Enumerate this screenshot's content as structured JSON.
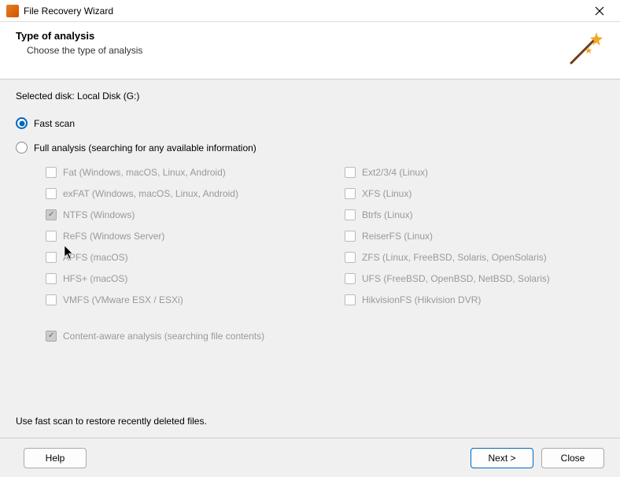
{
  "window": {
    "title": "File Recovery Wizard"
  },
  "header": {
    "heading": "Type of analysis",
    "subheading": "Choose the type of analysis"
  },
  "main": {
    "selected_disk_label": "Selected disk: Local Disk (G:)",
    "radio": {
      "fast": {
        "label": "Fast scan",
        "selected": true
      },
      "full": {
        "label": "Full analysis (searching for any available information)",
        "selected": false
      }
    },
    "filesystems_left": [
      {
        "label": "Fat (Windows, macOS, Linux, Android)",
        "checked": false
      },
      {
        "label": "exFAT (Windows, macOS, Linux, Android)",
        "checked": false
      },
      {
        "label": "NTFS (Windows)",
        "checked": true
      },
      {
        "label": "ReFS (Windows Server)",
        "checked": false
      },
      {
        "label": "APFS (macOS)",
        "checked": false
      },
      {
        "label": "HFS+ (macOS)",
        "checked": false
      },
      {
        "label": "VMFS (VMware ESX / ESXi)",
        "checked": false
      }
    ],
    "filesystems_right": [
      {
        "label": "Ext2/3/4 (Linux)",
        "checked": false
      },
      {
        "label": "XFS (Linux)",
        "checked": false
      },
      {
        "label": "Btrfs (Linux)",
        "checked": false
      },
      {
        "label": "ReiserFS (Linux)",
        "checked": false
      },
      {
        "label": "ZFS (Linux, FreeBSD, Solaris, OpenSolaris)",
        "checked": false
      },
      {
        "label": "UFS (FreeBSD, OpenBSD, NetBSD, Solaris)",
        "checked": false
      },
      {
        "label": "HikvisionFS (Hikvision DVR)",
        "checked": false
      }
    ],
    "content_aware": {
      "label": "Content-aware analysis (searching file contents)",
      "checked": true
    },
    "hint": "Use fast scan to restore recently deleted files."
  },
  "footer": {
    "help": "Help",
    "next": "Next >",
    "close": "Close"
  }
}
